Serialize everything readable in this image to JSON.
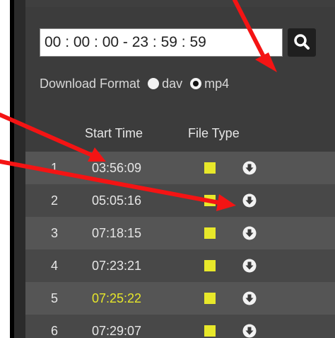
{
  "toolbar": {
    "time_range": "00 : 00 : 00 - 23 : 59 : 59"
  },
  "download": {
    "label": "Download Format",
    "options": [
      {
        "label": "dav",
        "selected": false
      },
      {
        "label": "mp4",
        "selected": true
      }
    ]
  },
  "table": {
    "headers": {
      "start_time": "Start Time",
      "file_type": "File Type"
    },
    "rows": [
      {
        "index": "1",
        "start_time": "03:56:09"
      },
      {
        "index": "2",
        "start_time": "05:05:16"
      },
      {
        "index": "3",
        "start_time": "07:18:15"
      },
      {
        "index": "4",
        "start_time": "07:23:21"
      },
      {
        "index": "5",
        "start_time": "07:25:22",
        "highlighted": true
      },
      {
        "index": "6",
        "start_time": "07:29:07"
      }
    ]
  },
  "colors": {
    "panel": "#3c3c3c",
    "row_light": "#555555",
    "row_dark": "#484848",
    "file_marker": "#e8e82a",
    "highlight_text": "#e6e62a",
    "annotation_arrow": "#f41414"
  },
  "icons": {
    "search": "magnifier-icon",
    "download": "circle-arrow-down-icon"
  }
}
